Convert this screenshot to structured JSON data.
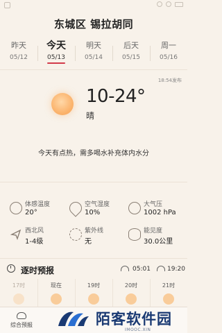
{
  "location": {
    "title": "东城区 锡拉胡同"
  },
  "days": [
    {
      "name": "昨天",
      "date": "05/12",
      "active": false
    },
    {
      "name": "今天",
      "date": "05/13",
      "active": true
    },
    {
      "name": "明天",
      "date": "05/14",
      "active": false
    },
    {
      "name": "后天",
      "date": "05/15",
      "active": false
    },
    {
      "name": "周一",
      "date": "05/16",
      "active": false
    }
  ],
  "current": {
    "published": "18:54发布",
    "temp_range": "10-24°",
    "condition": "晴",
    "condition_icon": "sun-icon",
    "advice": "今天有点热，需多喝水补充体内水分"
  },
  "metrics": [
    {
      "label": "体感温度",
      "value": "20°",
      "icon": "thermometer-icon"
    },
    {
      "label": "空气湿度",
      "value": "10%",
      "icon": "humidity-icon"
    },
    {
      "label": "大气压",
      "value": "1002 hPa",
      "icon": "pressure-icon"
    },
    {
      "label": "西北风",
      "value": "1-4级",
      "icon": "wind-icon"
    },
    {
      "label": "紫外线",
      "value": "无",
      "icon": "uv-icon"
    },
    {
      "label": "能见度",
      "value": "30.0公里",
      "icon": "visibility-icon"
    }
  ],
  "hourly": {
    "title": "逐时预报",
    "sunrise": "05:01",
    "sunset": "19:20",
    "times": [
      {
        "time": "17时",
        "past": true
      },
      {
        "time": "现在",
        "past": false
      },
      {
        "time": "19时",
        "past": false
      },
      {
        "time": "20时",
        "past": false
      },
      {
        "time": "21时",
        "past": false
      }
    ]
  },
  "nav": {
    "tab_label": "综合预报"
  },
  "watermark": {
    "text": "陌客软件园",
    "sub": "IMOOC.XIN"
  },
  "colors": {
    "accent": "#d23a4a",
    "background": "#f8f2ea",
    "sun": "#fbb46e",
    "watermark": "#1a3a73"
  }
}
